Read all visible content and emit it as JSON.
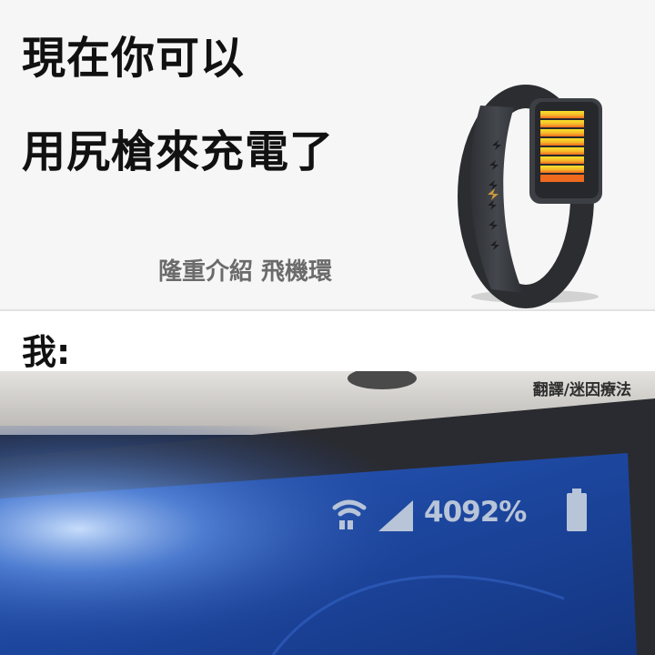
{
  "headline": {
    "line1": "現在你可以",
    "line2": "用尻槍來充電了"
  },
  "product_intro": "隆重介紹 飛機環",
  "reaction_label": "我:",
  "credit": "翻譯/迷因療法",
  "phone_status": {
    "battery_text": "4092%",
    "icons": [
      "wifi-icon",
      "cell-signal-icon",
      "battery-icon"
    ]
  },
  "colors": {
    "band_gray": "#e0e0e0",
    "wristband": "#3b3d42",
    "led_top": "#f8e22c",
    "led_bottom": "#ef6a1e",
    "screen_blue": "#1d4aa8",
    "status_text": "#b8c4d8"
  }
}
